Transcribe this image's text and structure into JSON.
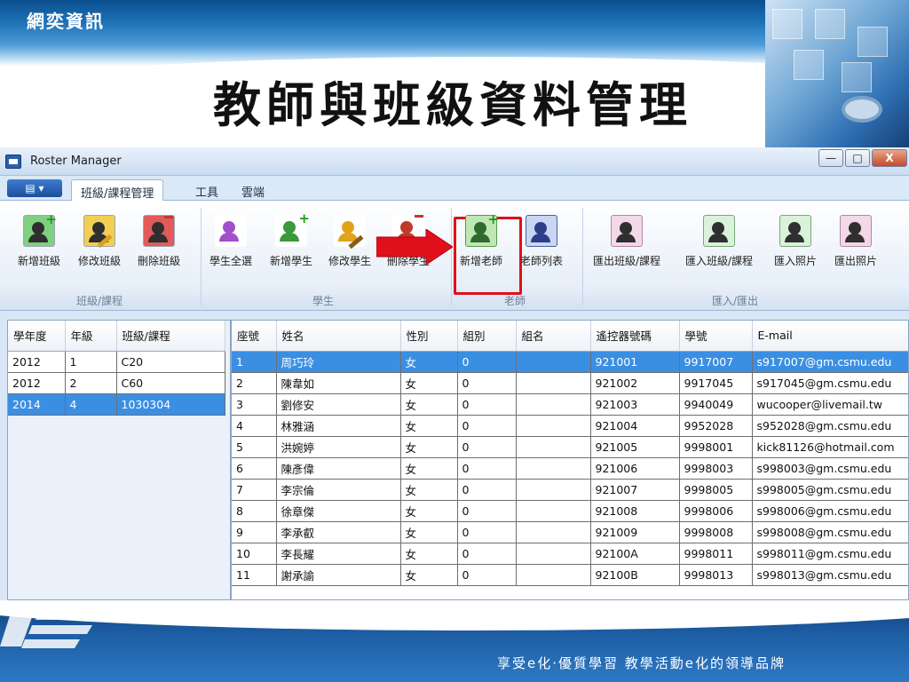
{
  "slide": {
    "brand": "網奕資訊",
    "title": "教師與班級資料管理",
    "tagline": "享受e化‧優質學習 教學活動e化的領導品牌"
  },
  "window": {
    "title": "Roster Manager",
    "buttons": [
      "—",
      "□",
      "X"
    ]
  },
  "tabs": [
    "班級/課程管理",
    "工具",
    "雲端"
  ],
  "active_tab": 0,
  "ribbon": {
    "groups": [
      {
        "label": "班級/課程",
        "items": [
          "新增班級",
          "修改班級",
          "刪除班級"
        ]
      },
      {
        "label": "學生",
        "items": [
          "學生全選",
          "新增學生",
          "修改學生",
          "刪除學生"
        ]
      },
      {
        "label": "老師",
        "items": [
          "新增老師",
          "老師列表"
        ]
      },
      {
        "label": "匯入/匯出",
        "items": [
          "匯出班級/課程",
          "匯入班級/課程",
          "匯入照片",
          "匯出照片"
        ]
      }
    ]
  },
  "class_table": {
    "headers": [
      "學年度",
      "年級",
      "班級/課程"
    ],
    "rows": [
      [
        "2012",
        "1",
        "C20"
      ],
      [
        "2012",
        "2",
        "C60"
      ],
      [
        "2014",
        "4",
        "1030304"
      ]
    ],
    "selected_row": 2
  },
  "student_table": {
    "headers": [
      "座號",
      "姓名",
      "性別",
      "組別",
      "組名",
      "遙控器號碼",
      "學號",
      "E-mail"
    ],
    "rows": [
      [
        "1",
        "周巧玲",
        "女",
        "0",
        "",
        "921001",
        "9917007",
        "s917007@gm.csmu.edu"
      ],
      [
        "2",
        "陳韋如",
        "女",
        "0",
        "",
        "921002",
        "9917045",
        "s917045@gm.csmu.edu"
      ],
      [
        "3",
        "劉修安",
        "女",
        "0",
        "",
        "921003",
        "9940049",
        "wucooper@livemail.tw"
      ],
      [
        "4",
        "林雅涵",
        "女",
        "0",
        "",
        "921004",
        "9952028",
        "s952028@gm.csmu.edu"
      ],
      [
        "5",
        "洪婉婷",
        "女",
        "0",
        "",
        "921005",
        "9998001",
        "kick81126@hotmail.com"
      ],
      [
        "6",
        "陳彥偉",
        "女",
        "0",
        "",
        "921006",
        "9998003",
        "s998003@gm.csmu.edu"
      ],
      [
        "7",
        "李宗倫",
        "女",
        "0",
        "",
        "921007",
        "9998005",
        "s998005@gm.csmu.edu"
      ],
      [
        "8",
        "徐章傑",
        "女",
        "0",
        "",
        "921008",
        "9998006",
        "s998006@gm.csmu.edu"
      ],
      [
        "9",
        "李承叡",
        "女",
        "0",
        "",
        "921009",
        "9998008",
        "s998008@gm.csmu.edu"
      ],
      [
        "10",
        "李長耀",
        "女",
        "0",
        "",
        "92100A",
        "9998011",
        "s998011@gm.csmu.edu"
      ],
      [
        "11",
        "謝承諭",
        "女",
        "0",
        "",
        "92100B",
        "9998013",
        "s998013@gm.csmu.edu"
      ]
    ],
    "selected_row": 0
  },
  "colors": {
    "accent": "#3b8fe3",
    "highlight_box": "#e0101a",
    "arrow": "#e0101a"
  },
  "icons": [
    "add-class-icon",
    "edit-class-icon",
    "delete-class-icon",
    "select-all-students-icon",
    "add-student-icon",
    "edit-student-icon",
    "delete-student-icon",
    "add-teacher-icon",
    "teacher-list-icon",
    "export-class-icon",
    "import-class-icon",
    "import-photo-icon",
    "export-photo-icon"
  ]
}
